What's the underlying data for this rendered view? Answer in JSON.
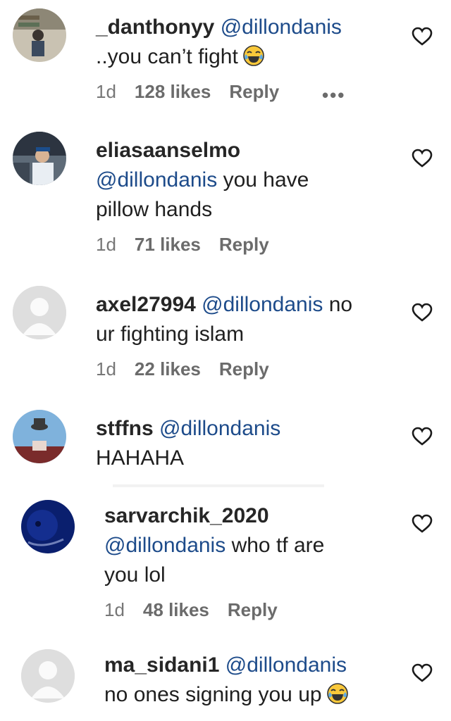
{
  "comments": [
    {
      "username": "_danthonyy",
      "mention": "@dillondanis",
      "text": "",
      "line2": "..you can’t fight",
      "emoji": "face-with-tears-of-joy",
      "time": "1d",
      "likes": "128 likes",
      "reply": "Reply",
      "more": "•••"
    },
    {
      "username": "eliasaanselmo",
      "mention": "@dillondanis",
      "text": "you have",
      "line3": "pillow hands",
      "time": "1d",
      "likes": "71 likes",
      "reply": "Reply"
    },
    {
      "username": "axel27994",
      "mention": "@dillondanis",
      "text": "no",
      "line2": "ur fighting islam",
      "time": "1d",
      "likes": "22 likes",
      "reply": "Reply"
    },
    {
      "username": "stffns",
      "mention": "@dillondanis",
      "line2": "HAHAHA"
    },
    {
      "username": "sarvarchik_2020",
      "mention": "@dillondanis",
      "text": "who tf are",
      "line3": "you lol",
      "time": "1d",
      "likes": "48 likes",
      "reply": "Reply"
    },
    {
      "username": "ma_sidani1",
      "mention": "@dillondanis",
      "line2": "no ones signing you up",
      "emoji": "face-with-tears-of-joy"
    }
  ],
  "icons": {
    "like": "heart-outline-icon",
    "more": "more-dots-icon",
    "avatar_default": "default-avatar-icon"
  }
}
